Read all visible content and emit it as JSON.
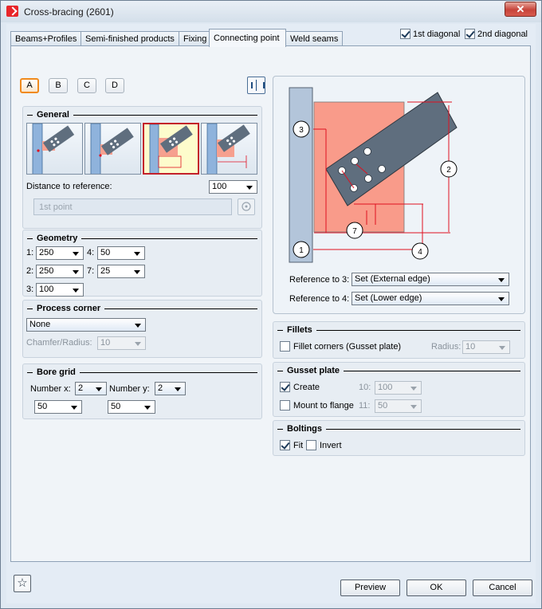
{
  "window": {
    "title": "Cross-bracing (2601)",
    "close_glyph": "✕"
  },
  "tabs": [
    {
      "label": "Beams+Profiles"
    },
    {
      "label": "Semi-finished products"
    },
    {
      "label": "Fixing"
    },
    {
      "label": "Connecting point",
      "active": true
    },
    {
      "label": "Weld seams"
    }
  ],
  "diagonals": {
    "first": {
      "label": "1st diagonal",
      "checked": true
    },
    "second": {
      "label": "2nd diagonal",
      "checked": true
    }
  },
  "variants": {
    "items": [
      "A",
      "B",
      "C",
      "D"
    ],
    "selected": "A"
  },
  "general": {
    "title": "General",
    "selected_variant_index": 2,
    "distance_label": "Distance to reference:",
    "distance_value": "100",
    "point_placeholder": "1st point"
  },
  "geometry": {
    "title": "Geometry",
    "fields": [
      {
        "label": "1:",
        "value": "250"
      },
      {
        "label": "4:",
        "value": "50"
      },
      {
        "label": "2:",
        "value": "250"
      },
      {
        "label": "7:",
        "value": "25"
      },
      {
        "label": "3:",
        "value": "100"
      }
    ]
  },
  "process_corner": {
    "title": "Process corner",
    "value": "None",
    "chamfer_label": "Chamfer/Radius:",
    "chamfer_value": "10"
  },
  "bore_grid": {
    "title": "Bore grid",
    "number_x_label": "Number x:",
    "number_x": "2",
    "number_y_label": "Number y:",
    "number_y": "2",
    "spacing_x": "50",
    "spacing_y": "50"
  },
  "diagram": {
    "markers": [
      "1",
      "2",
      "3",
      "4",
      "7"
    ],
    "ref3_label": "Reference to 3:",
    "ref3_value": "Set (External edge)",
    "ref4_label": "Reference to 4:",
    "ref4_value": "Set (Lower edge)"
  },
  "fillets": {
    "title": "Fillets",
    "fillet_label": "Fillet corners (Gusset plate)",
    "fillet_checked": false,
    "radius_label": "Radius:",
    "radius_value": "10"
  },
  "gusset": {
    "title": "Gusset plate",
    "create_label": "Create",
    "create_checked": true,
    "mount_label": "Mount to flange",
    "mount_checked": false,
    "field10_label": "10:",
    "field10_value": "100",
    "field11_label": "11:",
    "field11_value": "50"
  },
  "boltings": {
    "title": "Boltings",
    "fit_label": "Fit",
    "fit_checked": true,
    "invert_label": "Invert",
    "invert_checked": false
  },
  "buttons": {
    "favorite_glyph": "☆",
    "preview": "Preview",
    "ok": "OK",
    "cancel": "Cancel"
  },
  "colors": {
    "plate": "#f99b8a",
    "profile": "#5f6e7e",
    "column": "#aac0da",
    "dimension": "#e01020",
    "selection": "#c3202a",
    "accent": "#f08a1c"
  }
}
